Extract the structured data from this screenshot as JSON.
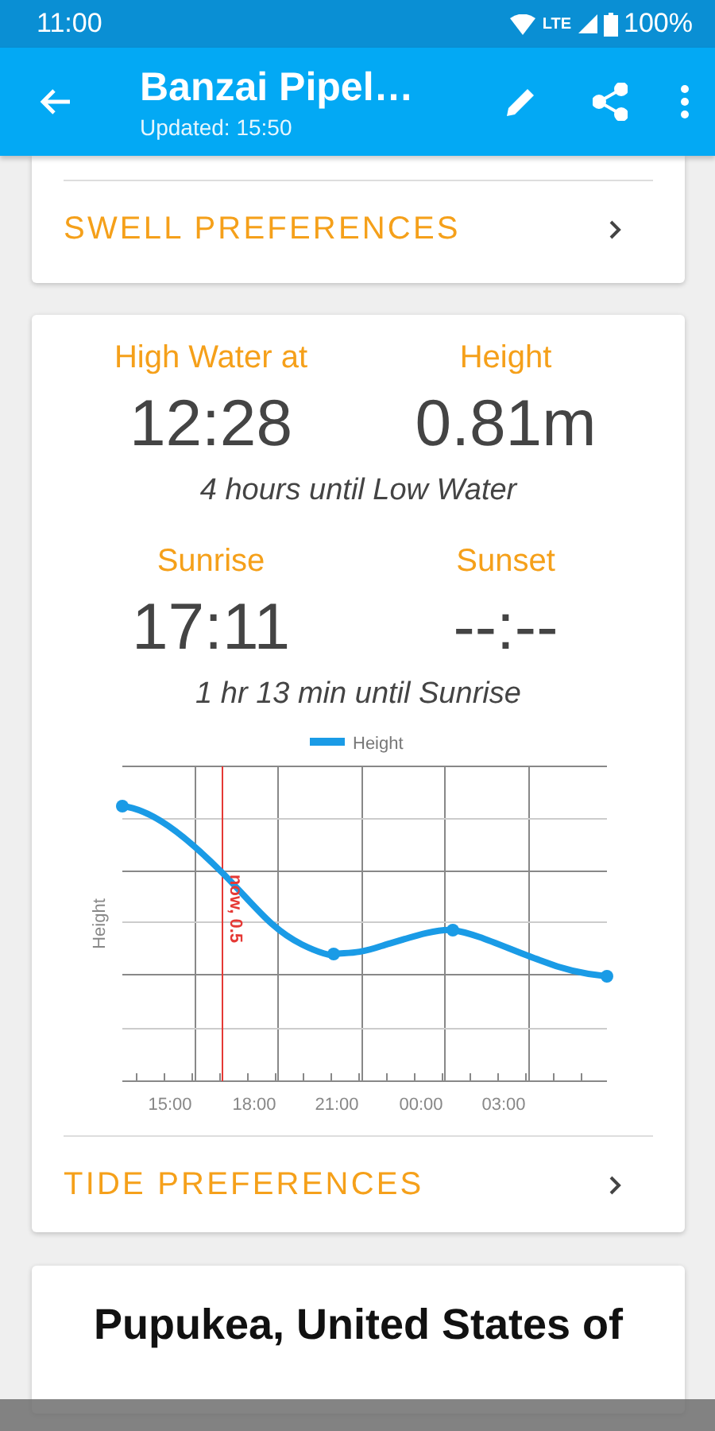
{
  "status_bar": {
    "time": "11:00",
    "network": "LTE",
    "battery": "100%"
  },
  "toolbar": {
    "title": "Banzai Pipel…",
    "subtitle": "Updated: 15:50"
  },
  "swell_preferences": {
    "label": "SWELL PREFERENCES"
  },
  "tide": {
    "stats": [
      {
        "label": "High Water at",
        "value": "12:28"
      },
      {
        "label": "Height",
        "value": "0.81m"
      }
    ],
    "tide_note": "4 hours until Low Water",
    "sun": [
      {
        "label": "Sunrise",
        "value": "17:11"
      },
      {
        "label": "Sunset",
        "value": "--:--"
      }
    ],
    "sun_note": "1 hr 13 min until Sunrise",
    "chart": {
      "legend": "Height",
      "y_label": "Height",
      "now_label": "now, 0.5",
      "x_labels": [
        "15:00",
        "18:00",
        "21:00",
        "00:00",
        "03:00"
      ]
    },
    "preferences": {
      "label": "TIDE PREFERENCES"
    }
  },
  "location": {
    "title": "Pupukea, United States of"
  }
}
